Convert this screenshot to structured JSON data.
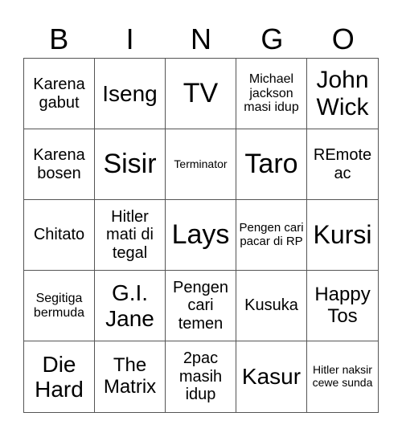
{
  "header": {
    "letters": [
      "B",
      "I",
      "N",
      "G",
      "O"
    ]
  },
  "grid": {
    "rows": [
      [
        "Karena gabut",
        "Iseng",
        "TV",
        "Michael jackson masi idup",
        "John Wick"
      ],
      [
        "Karena bosen",
        "Sisir",
        "Terminator",
        "Taro",
        "REmote ac"
      ],
      [
        "Chitato",
        "Hitler mati di tegal",
        "Lays",
        "Pengen cari pacar di RP",
        "Kursi"
      ],
      [
        "Segitiga bermuda",
        "G.I. Jane",
        "Pengen cari temen",
        "Kusuka",
        "Happy Tos"
      ],
      [
        "Die Hard",
        "The Matrix",
        "2pac masih idup",
        "Kasur",
        "Hitler naksir cewe sunda"
      ]
    ]
  }
}
